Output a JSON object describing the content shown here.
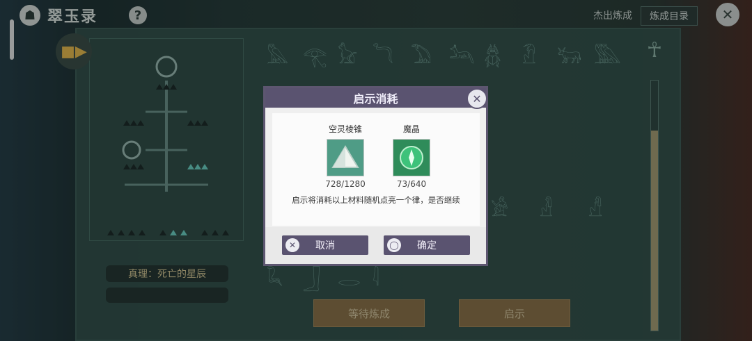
{
  "app": {
    "title": "翠玉录",
    "logo_icon": "sphinx-logo-icon",
    "help_icon": "question-mark-icon"
  },
  "header": {
    "top_label": "杰出炼成",
    "catalog_button": "炼成目录",
    "close_icon": "close-x-icon"
  },
  "left": {
    "truth_label": "真理：死亡的星辰",
    "camera_icon": "camera-icon"
  },
  "progress": {
    "value": 0.8
  },
  "bottom": {
    "wait_button": "等待炼成",
    "reveal_button": "启示"
  },
  "dialog": {
    "title": "启示消耗",
    "items": [
      {
        "name": "空灵棱锥",
        "count": "728/1280",
        "icon": "pyramid-icon"
      },
      {
        "name": "魔晶",
        "count": "73/640",
        "icon": "magic-crystal-icon"
      }
    ],
    "message": "启示将消耗以上材料随机点亮一个律，是否继续",
    "cancel_label": "取消",
    "confirm_label": "确定"
  },
  "colors": {
    "dialog_header": "#5a5370",
    "accent_gold": "#8a6f46"
  }
}
